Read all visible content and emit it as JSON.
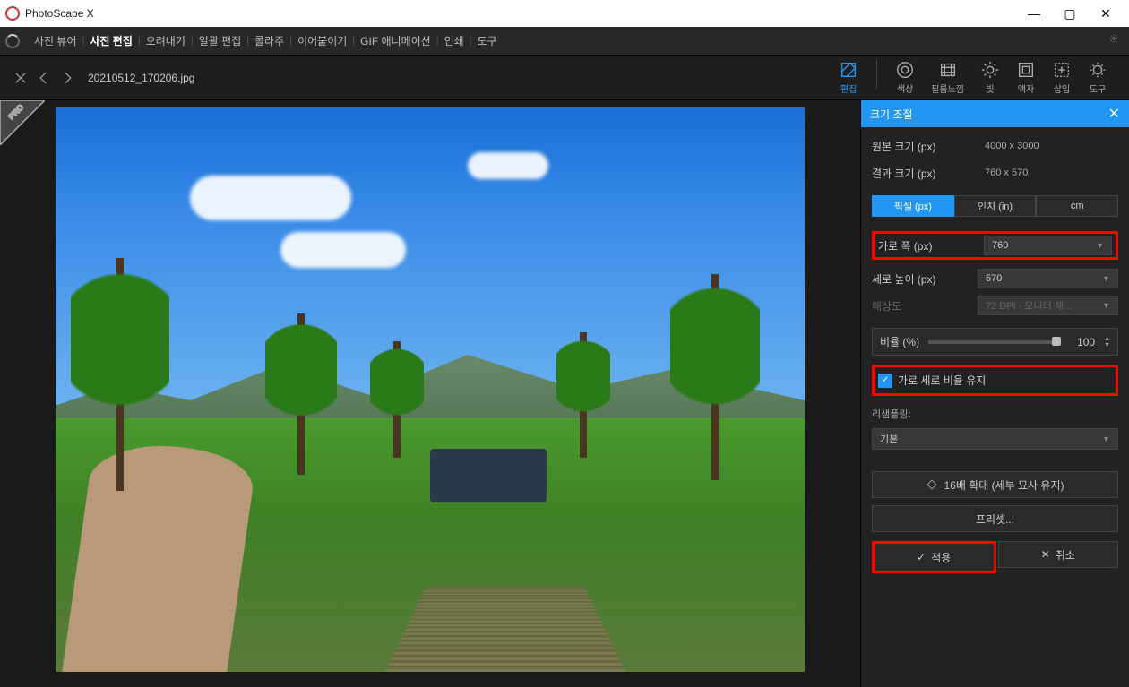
{
  "app": {
    "title": "PhotoScape X"
  },
  "win": {
    "min": "—",
    "max": "▢",
    "close": "✕"
  },
  "menu": {
    "items": [
      "사진 뷰어",
      "사진 편집",
      "오려내기",
      "일괄 편집",
      "콜라주",
      "이어붙이기",
      "GIF 애니메이션",
      "인쇄",
      "도구"
    ],
    "active_index": 1
  },
  "nav": {
    "filename": "20210512_170206.jpg"
  },
  "tools": {
    "items": [
      "편집",
      "색상",
      "필름느낌",
      "빛",
      "액자",
      "삽입",
      "도구"
    ],
    "active_index": 0
  },
  "panel": {
    "title": "크기 조절",
    "orig_label": "원본 크기 (px)",
    "orig_value": "4000 x 3000",
    "result_label": "결과 크기 (px)",
    "result_value": "760 x 570",
    "units": {
      "px": "픽셀 (px)",
      "in": "인치 (in)",
      "cm": "cm"
    },
    "width_label": "가로 폭 (px)",
    "width_value": "760",
    "height_label": "세로 높이 (px)",
    "height_value": "570",
    "dpi_label": "해상도",
    "dpi_value": "72 DPI - 모니터 해…",
    "ratio_label": "비율 (%)",
    "ratio_value": "100",
    "aspect_label": "가로 세로 비율 유지",
    "resample_label": "리샘플링:",
    "resample_value": "기본",
    "enlarge16": "16배 확대 (세부 묘사 유지)",
    "preset": "프리셋...",
    "apply": "적용",
    "cancel": "취소"
  },
  "pro": "PRO"
}
